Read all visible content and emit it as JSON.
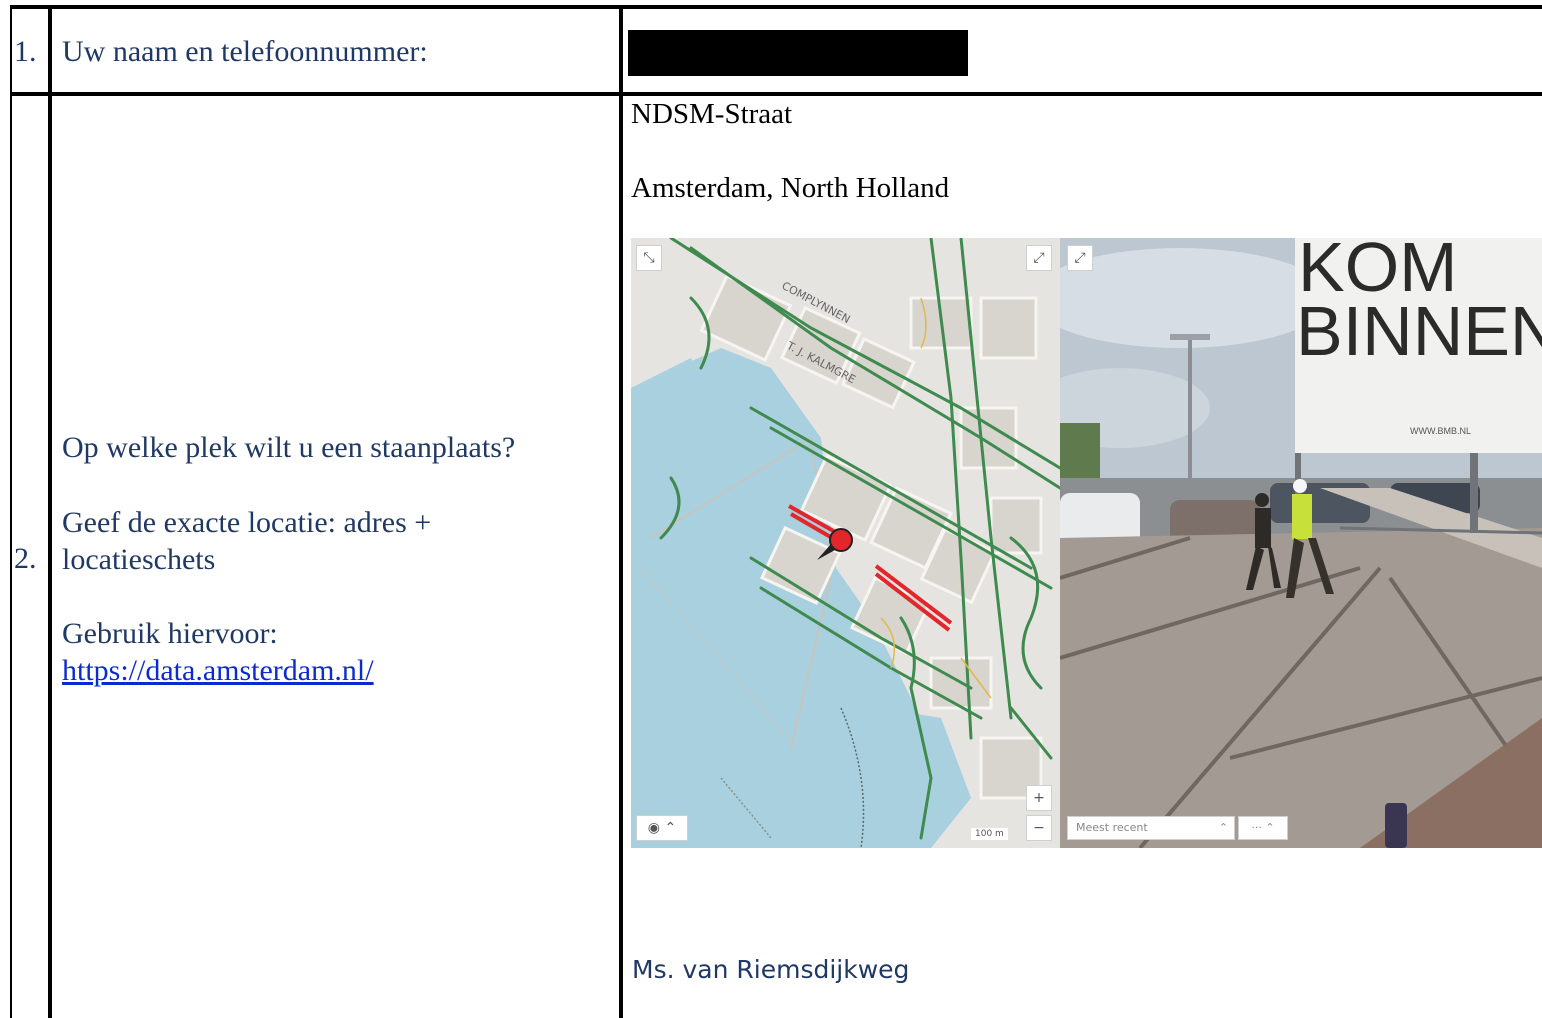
{
  "form": {
    "row1": {
      "number": "1.",
      "question": "Uw naam en telefoonnummer:"
    },
    "row2": {
      "number": "2.",
      "question_1": "Op welke plek wilt u een staanplaats?",
      "question_2a": "Geef de exacte locatie: adres +",
      "question_2b": "locatieschets",
      "question_3": "Gebruik hiervoor:",
      "link": "https://data.amsterdam.nl/"
    }
  },
  "answer": {
    "street": "NDSM-Straat",
    "city": "Amsterdam, North Holland",
    "caption": "Ms. van Riemsdijkweg"
  },
  "map": {
    "label_top": "COMPLYNNEN",
    "label_mid": "T. J. KALMGRE",
    "scale": "100 m",
    "zoom_in": "+",
    "zoom_out": "−"
  },
  "street_view": {
    "billboard_line1": "KOM",
    "billboard_line2": "BINNEN",
    "billboard_url": "WWW.BMB.NL",
    "filter_label": "Meest recent"
  },
  "colors": {
    "form_text": "#1f3864",
    "link": "#0b2bd0",
    "water": "#a9d0df",
    "route_green": "#3f8a4e",
    "route_red": "#e3262b"
  }
}
